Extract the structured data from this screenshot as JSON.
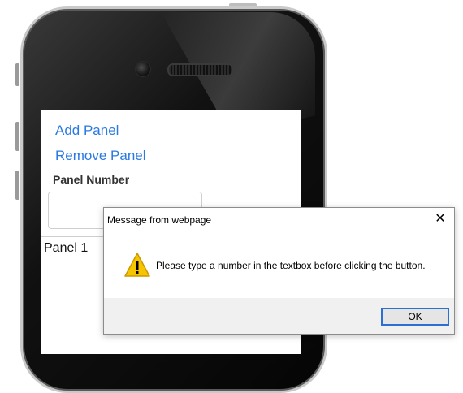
{
  "screen": {
    "add_panel_link": "Add Panel",
    "remove_panel_link": "Remove Panel",
    "panel_number_label": "Panel Number",
    "panel_number_input_value": "",
    "panel_label": "Panel 1"
  },
  "dialog": {
    "title": "Message from webpage",
    "close_glyph": "✕",
    "message": "Please type a number in the textbox before clicking the button.",
    "ok_label": "OK",
    "icon": "warning-icon"
  },
  "colors": {
    "link": "#2a7ae2",
    "warning_fill": "#f7c500",
    "ok_border": "#2a6fd1"
  }
}
